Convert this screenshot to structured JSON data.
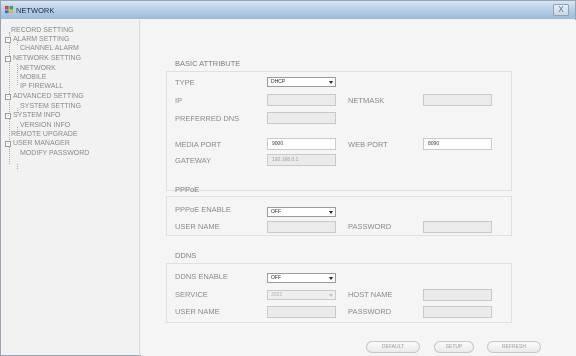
{
  "window": {
    "title": "NETWORK",
    "close_label": "X"
  },
  "tree": [
    {
      "label": "RECORD SETTING",
      "expander": ""
    },
    {
      "label": "ALARM SETTING",
      "expander": "-"
    },
    {
      "label": "CHANNEL ALARM",
      "expander": ""
    },
    {
      "label": "NETWORK SETTING",
      "expander": "-"
    },
    {
      "label": "NETWORK",
      "expander": ""
    },
    {
      "label": "MOBILE",
      "expander": ""
    },
    {
      "label": "IP FIREWALL",
      "expander": ""
    },
    {
      "label": "ADVANCED SETTING",
      "expander": "-"
    },
    {
      "label": "SYSTEM SETTING",
      "expander": ""
    },
    {
      "label": "SYSTEM INFO",
      "expander": "-"
    },
    {
      "label": "VERSION INFO",
      "expander": ""
    },
    {
      "label": "REMOTE UPGRADE",
      "expander": ""
    },
    {
      "label": "USER MANAGER",
      "expander": "-"
    },
    {
      "label": "MODIFY PASSWORD",
      "expander": ""
    }
  ],
  "basic": {
    "title": "BASIC ATTRIBUTE",
    "type_label": "TYPE",
    "type_value": "DHCP",
    "ip_label": "IP",
    "ip_value": "",
    "netmask_label": "NETMASK",
    "netmask_value": "",
    "dns_label": "PREFERRED DNS",
    "dns_value": "",
    "media_port_label": "MEDIA PORT",
    "media_port_value": "9000",
    "web_port_label": "WEB PORT",
    "web_port_value": "8090",
    "gateway_label": "GATEWAY",
    "gateway_value": "192.168.0.1"
  },
  "pppoe": {
    "title": "PPPoE",
    "enable_label": "PPPoE ENABLE",
    "enable_value": "OFF",
    "user_label": "USER NAME",
    "user_value": "",
    "password_label": "PASSWORD",
    "password_value": ""
  },
  "ddns": {
    "title": "DDNS",
    "enable_label": "DDNS ENABLE",
    "enable_value": "OFF",
    "service_label": "SERVICE",
    "service_value": "3322",
    "host_label": "HOST NAME",
    "host_value": "",
    "user_label": "USER NAME",
    "user_value": "",
    "password_label": "PASSWORD",
    "password_value": ""
  },
  "buttons": {
    "default": "DEFAULT",
    "setup": "SETUP",
    "refresh": "REFRESH"
  }
}
